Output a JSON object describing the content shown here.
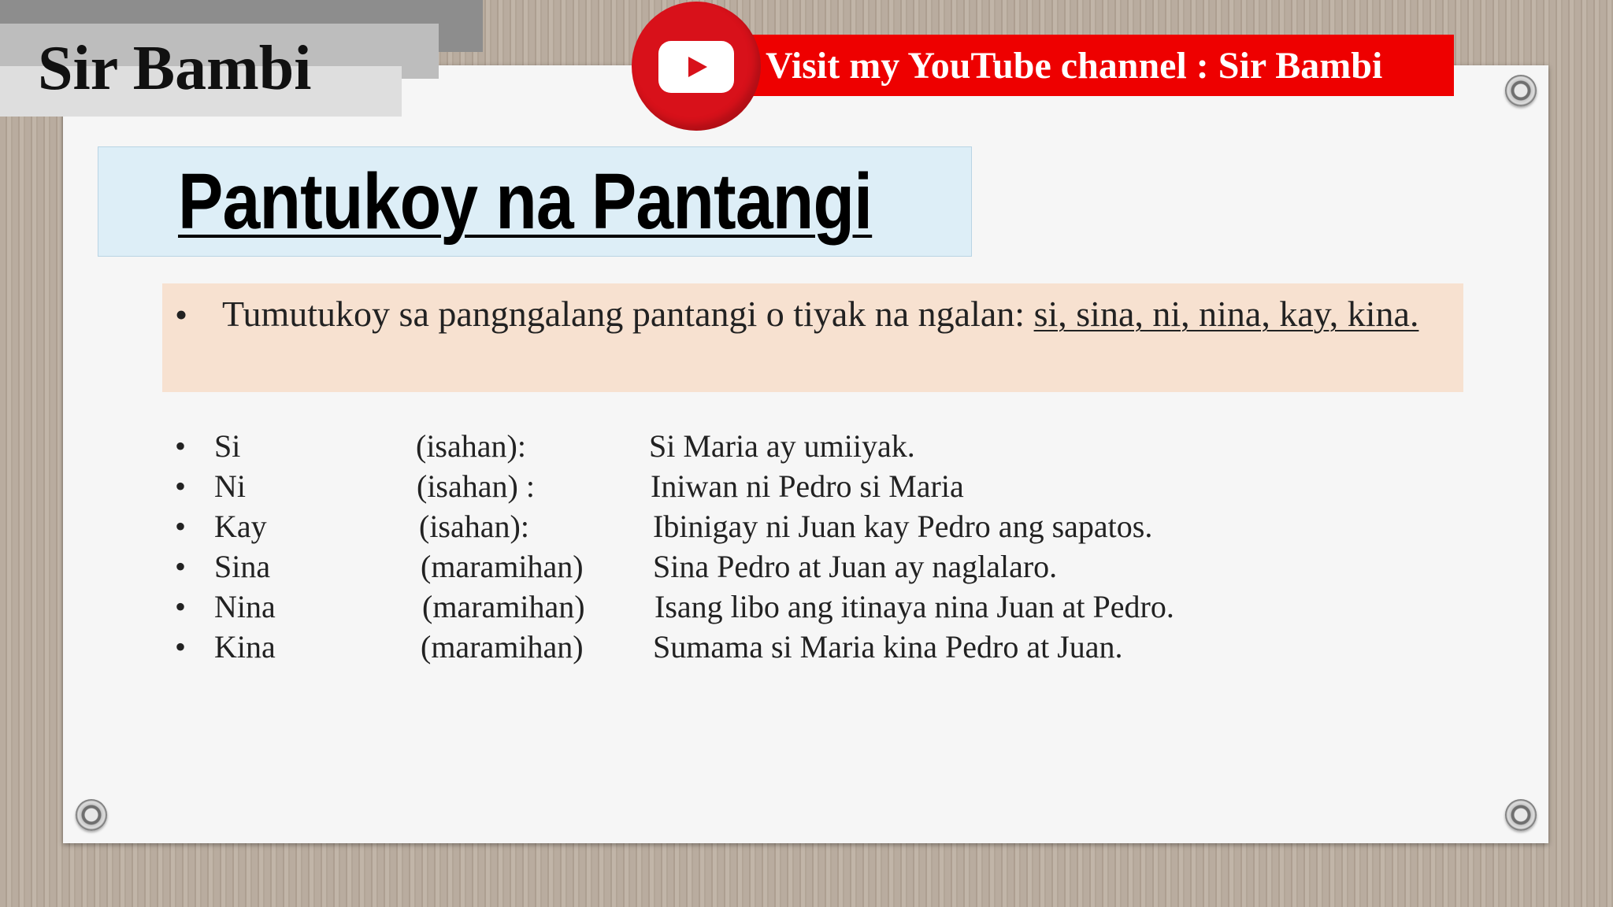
{
  "header": {
    "brand": "Sir Bambi",
    "youtube_banner": "Visit my YouTube channel : Sir Bambi",
    "youtube_icon": "youtube-play-icon"
  },
  "slide": {
    "title": "Pantukoy na Pantangi",
    "definition": {
      "bullet": "•",
      "text": "Tumutukoy sa pangngalang pantangi o tiyak na ngalan: ",
      "articles": "si, sina, ni, nina, kay, kina."
    },
    "rows": [
      {
        "bullet": "•",
        "article": "Si",
        "number": "(isahan):",
        "example": "Si Maria ay umiiyak."
      },
      {
        "bullet": "•",
        "article": "Ni",
        "number": "(isahan) :",
        "example": "Iniwan ni Pedro si Maria"
      },
      {
        "bullet": "•",
        "article": "Kay",
        "number": "(isahan):",
        "example": "Ibinigay ni Juan kay Pedro ang sapatos."
      },
      {
        "bullet": "•",
        "article": "Sina",
        "number": "(maramihan)",
        "example": "Sina Pedro at Juan ay naglalaro."
      },
      {
        "bullet": "•",
        "article": "Nina",
        "number": "(maramihan)",
        "example": "Isang libo ang itinaya nina Juan at Pedro."
      },
      {
        "bullet": "•",
        "article": "Kina",
        "number": "(maramihan)",
        "example": "Sumama si Maria kina Pedro at Juan."
      }
    ]
  },
  "colors": {
    "youtube_red": "#ee0000",
    "title_box": "#ddeef7",
    "definition_box": "#f7e1d0",
    "paper": "#f6f6f6"
  }
}
